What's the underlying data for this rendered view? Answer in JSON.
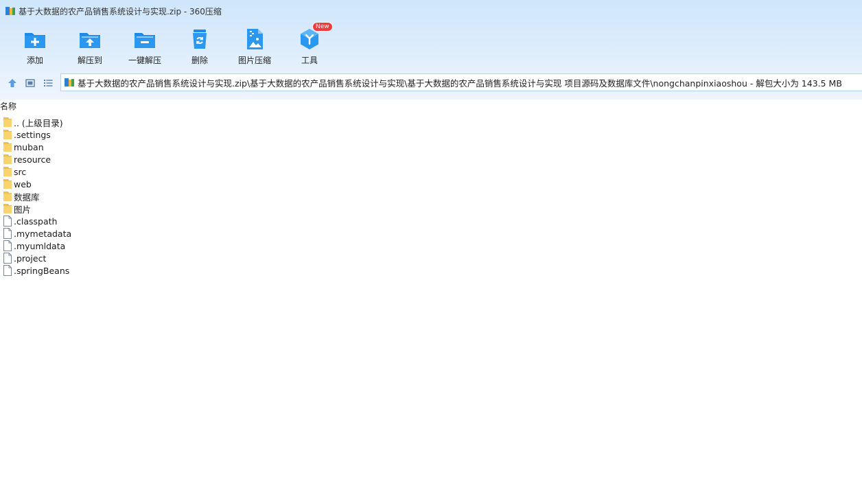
{
  "window": {
    "title": "基于大数据的农产品销售系统设计与实现.zip - 360压缩"
  },
  "toolbar": {
    "items": [
      {
        "label": "添加",
        "icon": "add-icon"
      },
      {
        "label": "解压到",
        "icon": "extract-to-icon"
      },
      {
        "label": "一键解压",
        "icon": "one-click-extract-icon"
      },
      {
        "label": "删除",
        "icon": "delete-icon"
      },
      {
        "label": "图片压缩",
        "icon": "image-compress-icon"
      },
      {
        "label": "工具",
        "icon": "tools-icon",
        "badge": "New"
      }
    ]
  },
  "address": {
    "path": "基于大数据的农产品销售系统设计与实现.zip\\基于大数据的农产品销售系统设计与实现\\基于大数据的农产品销售系统设计与实现 项目源码及数据库文件\\nongchanpinxiaoshou - 解包大小为 143.5 MB"
  },
  "list": {
    "column_name": "名称",
    "files": [
      {
        "name": ".. (上级目录)",
        "type": "folder"
      },
      {
        "name": ".settings",
        "type": "folder"
      },
      {
        "name": "muban",
        "type": "folder"
      },
      {
        "name": "resource",
        "type": "folder"
      },
      {
        "name": "src",
        "type": "folder"
      },
      {
        "name": "web",
        "type": "folder"
      },
      {
        "name": "数据库",
        "type": "folder"
      },
      {
        "name": "图片",
        "type": "folder"
      },
      {
        "name": ".classpath",
        "type": "file"
      },
      {
        "name": ".mymetadata",
        "type": "file"
      },
      {
        "name": ".myumldata",
        "type": "file"
      },
      {
        "name": ".project",
        "type": "file"
      },
      {
        "name": ".springBeans",
        "type": "file"
      }
    ]
  },
  "colors": {
    "accent": "#1e8ae6",
    "folder": "#f7c95a",
    "badge": "#ef3b3b"
  }
}
